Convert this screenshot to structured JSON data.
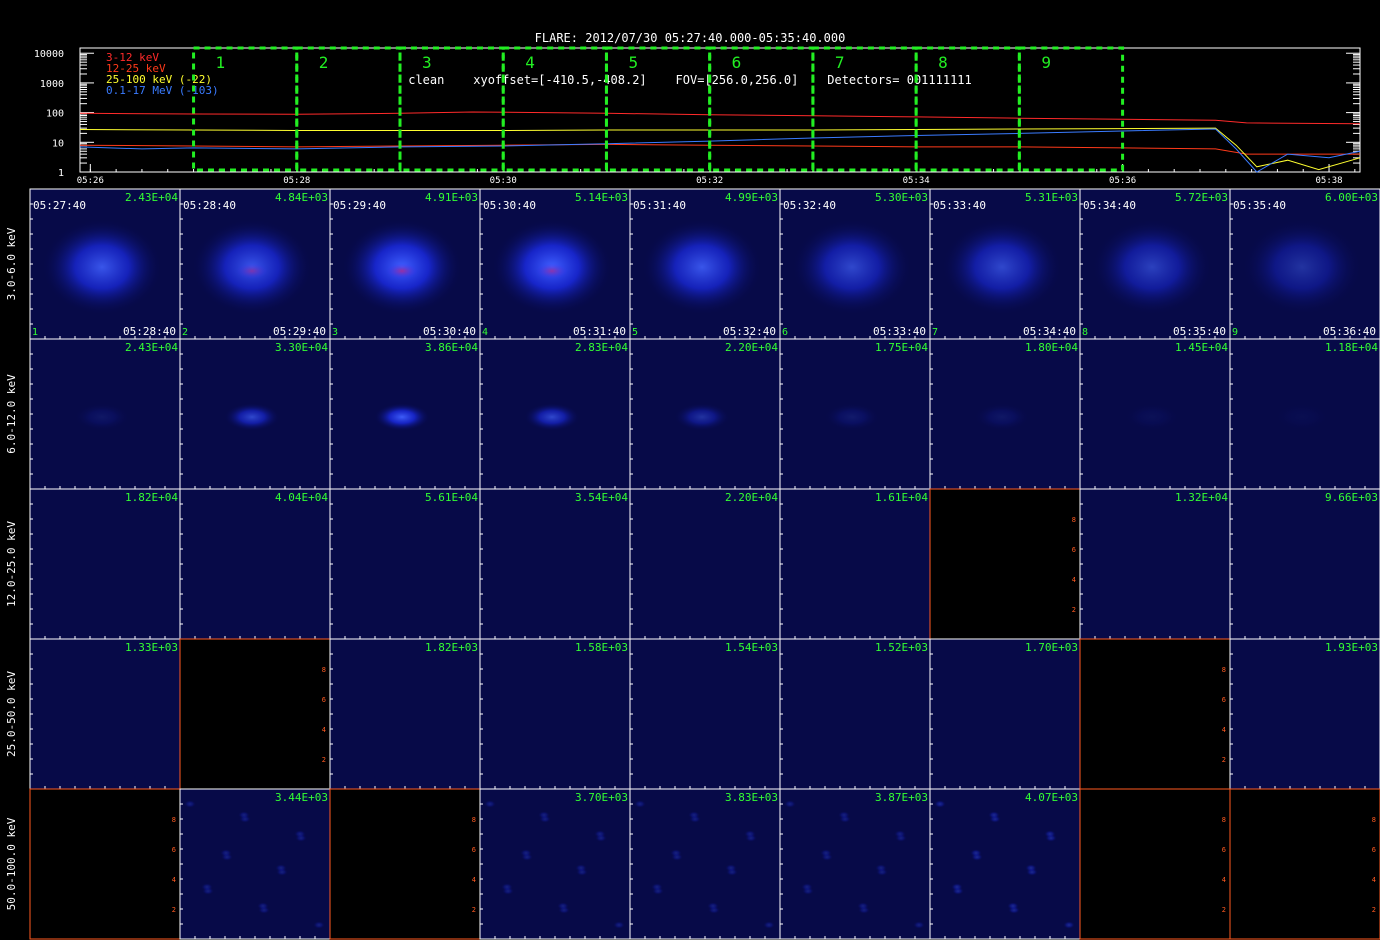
{
  "header": {
    "title": "FLARE: 2012/07/30 05:27:40.000-05:35:40.000",
    "subtitle": "clean    xyoffset=[-410.5,-408.2]    FOV=[256.0,256.0]    Detectors= 001111111"
  },
  "colors": {
    "band1": "#ff2a2a",
    "band2": "#ff3a1a",
    "band3": "#ffff30",
    "band4": "#3a7bff",
    "interval_box": "#22ee22",
    "flux": "#33ff33",
    "empty_axis": "#ff5a20"
  },
  "chart_data": [
    {
      "type": "line",
      "title": "",
      "yscale": "log",
      "ylim": [
        1,
        15000
      ],
      "yticks": [
        "1",
        "10",
        "100",
        "1000",
        "10000"
      ],
      "xlim": [
        5.9,
        18.3
      ],
      "xticks": [
        "05:26",
        "05:28",
        "05:30",
        "05:32",
        "05:34",
        "05:36",
        "05:38"
      ],
      "xtick_minutes": [
        6,
        8,
        10,
        12,
        14,
        16,
        18
      ],
      "series": [
        {
          "name": "3-12 keV",
          "color": "#ff2a2a",
          "x": [
            5.9,
            7,
            8,
            9,
            9.7,
            10.4,
            11,
            12,
            13,
            14,
            15,
            16,
            16.9,
            17.2,
            18.3
          ],
          "y": [
            95,
            90,
            88,
            95,
            105,
            100,
            95,
            85,
            78,
            72,
            65,
            60,
            55,
            45,
            42
          ]
        },
        {
          "name": "12-25 keV",
          "color": "#ff3a1a",
          "x": [
            5.9,
            7,
            8,
            9,
            10,
            11,
            12,
            13,
            14,
            15,
            16,
            16.9,
            17.2,
            18.3
          ],
          "y": [
            8,
            7.5,
            7,
            7.5,
            8,
            8.5,
            8,
            7.5,
            7,
            7,
            6.5,
            6,
            4,
            4
          ]
        },
        {
          "name": "25-100 keV (-22)",
          "color": "#ffff30",
          "x": [
            5.9,
            7,
            8,
            9,
            10,
            11,
            12,
            13,
            14,
            15,
            16,
            16.9,
            17.1,
            17.3,
            17.6,
            17.9,
            18.3
          ],
          "y": [
            27,
            26,
            25,
            25,
            25,
            26,
            26,
            26,
            27,
            28,
            29,
            30,
            8,
            1.5,
            2.5,
            1.2,
            3
          ]
        },
        {
          "name": "0.1-17 MeV (-103)",
          "color": "#3a7bff",
          "x": [
            5.9,
            6.5,
            7,
            8,
            9,
            10,
            11,
            12,
            13,
            14,
            15,
            16,
            16.9,
            17.1,
            17.3,
            17.6,
            18,
            18.3
          ],
          "y": [
            7,
            6,
            6.5,
            6,
            7,
            7.5,
            9,
            11,
            14,
            17,
            20,
            24,
            28,
            6,
            1,
            4,
            3,
            5
          ]
        }
      ],
      "intervals": [
        "1",
        "2",
        "3",
        "4",
        "5",
        "6",
        "7",
        "8",
        "9"
      ],
      "interval_start_minutes": [
        7.0,
        8.0,
        9.0,
        10.0,
        11.0,
        12.0,
        13.0,
        14.0,
        15.0
      ],
      "interval_end_minutes": [
        8.0,
        9.0,
        10.0,
        11.0,
        12.0,
        13.0,
        14.0,
        15.0,
        16.0
      ]
    },
    {
      "type": "heatmap",
      "rows": [
        "3.0-6.0 keV",
        "6.0-12.0 keV",
        "12.0-25.0 keV",
        "25.0-50.0 keV",
        "50.0-100.0 keV"
      ],
      "start_times": [
        "05:27:40",
        "05:28:40",
        "05:29:40",
        "05:30:40",
        "05:31:40",
        "05:32:40",
        "05:33:40",
        "05:34:40",
        "05:35:40"
      ],
      "end_times": [
        "05:28:40",
        "05:29:40",
        "05:30:40",
        "05:31:40",
        "05:32:40",
        "05:33:40",
        "05:34:40",
        "05:35:40",
        "05:36:40"
      ],
      "panel_numbers": [
        "1",
        "2",
        "3",
        "4",
        "5",
        "6",
        "7",
        "8",
        "9"
      ],
      "max_values": [
        [
          "2.43E+04",
          "4.84E+03",
          "4.91E+03",
          "5.14E+03",
          "4.99E+03",
          "5.30E+03",
          "5.31E+03",
          "5.72E+03",
          "6.00E+03"
        ],
        [
          "2.43E+04",
          "3.30E+04",
          "3.86E+04",
          "2.83E+04",
          "2.20E+04",
          "1.75E+04",
          "1.80E+04",
          "1.45E+04",
          "1.18E+04"
        ],
        [
          "1.82E+04",
          "4.04E+04",
          "5.61E+04",
          "3.54E+04",
          "2.20E+04",
          "1.61E+04",
          "",
          "1.32E+04",
          "9.66E+03"
        ],
        [
          "1.33E+03",
          "",
          "1.82E+03",
          "1.58E+03",
          "1.54E+03",
          "1.52E+03",
          "1.70E+03",
          "",
          "1.93E+03"
        ],
        [
          "",
          "3.44E+03",
          "",
          "3.70E+03",
          "3.83E+03",
          "3.87E+03",
          "4.07E+03",
          "",
          ""
        ]
      ],
      "blob_intensity": [
        [
          0.55,
          0.55,
          0.75,
          0.65,
          0.55,
          0.45,
          0.45,
          0.4,
          0.3
        ],
        [
          0.1,
          0.45,
          0.6,
          0.45,
          0.3,
          0.12,
          0.1,
          0.05,
          0.03
        ],
        [
          0,
          0,
          0,
          0,
          0,
          0,
          0,
          0,
          0
        ],
        [
          0,
          0,
          0,
          0,
          0,
          0,
          0,
          0,
          0
        ],
        [
          0,
          0.15,
          0,
          0.15,
          0.15,
          0.15,
          0.2,
          0,
          0
        ]
      ],
      "blob_has_core": [
        [
          false,
          true,
          true,
          true,
          false,
          false,
          false,
          false,
          false
        ],
        [
          false,
          false,
          false,
          false,
          false,
          false,
          false,
          false,
          false
        ],
        [
          false,
          false,
          false,
          false,
          false,
          false,
          false,
          false,
          false
        ],
        [
          false,
          false,
          false,
          false,
          false,
          false,
          false,
          false,
          false
        ],
        [
          false,
          false,
          false,
          false,
          false,
          false,
          false,
          false,
          false
        ]
      ],
      "empty_panels": [
        [
          2,
          6
        ],
        [
          3,
          1
        ],
        [
          3,
          7
        ],
        [
          4,
          0
        ],
        [
          4,
          2
        ],
        [
          4,
          7
        ],
        [
          4,
          8
        ]
      ],
      "empty_axis_ticks": [
        "2",
        "4",
        "6",
        "8"
      ]
    }
  ]
}
